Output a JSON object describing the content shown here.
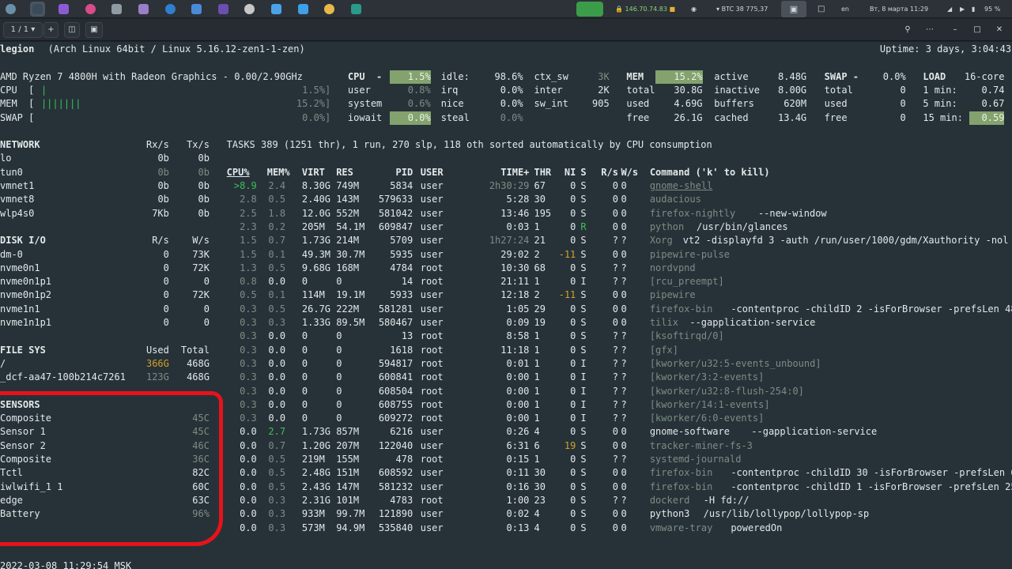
{
  "topbar": {
    "apps": [
      "activities-icon",
      "terminal-icon",
      "firefox-icon",
      "podcast-icon",
      "settings-icon",
      "gimp-icon",
      "vscode-icon",
      "files-icon",
      "proton-icon",
      "obs-icon",
      "atom-icon",
      "chrome-icon",
      "notes-icon",
      "vk-icon"
    ],
    "vpn": "146.70.74.83",
    "btc": "BTC 38 775,37",
    "lang": "en",
    "clock": "Вт, 8 марта  11:29",
    "battery": "95 %"
  },
  "termbar": {
    "tab": "1 / 1",
    "add": "+"
  },
  "hostline": {
    "host": "legion",
    "os": "(Arch Linux 64bit / Linux 5.16.12-zen1-1-zen)",
    "uptime": "Uptime: 3 days, 3:04:43"
  },
  "quick": {
    "cpu_name": "AMD Ryzen 7 4800H with Radeon Graphics - 0.00/2.90GHz",
    "rows": [
      {
        "label": "CPU  [",
        "bar": "|",
        "pct": "1.5%]"
      },
      {
        "label": "MEM  [",
        "bar": "|||||||",
        "pct": "15.2%]"
      },
      {
        "label": "SWAP [",
        "bar": "",
        "pct": "0.0%]"
      }
    ]
  },
  "cpu": {
    "title": "CPU  -",
    "total": "1.5%",
    "col1": [
      [
        "user",
        "0.8%"
      ],
      [
        "system",
        "0.6%"
      ],
      [
        "iowait",
        "0.0%"
      ]
    ],
    "col2": [
      [
        "idle:",
        "98.6%"
      ],
      [
        "irq",
        "0.0%"
      ],
      [
        "nice",
        "0.0%"
      ],
      [
        "steal",
        "0.0%"
      ]
    ],
    "col3": [
      [
        "ctx_sw",
        "3K"
      ],
      [
        "inter",
        "2K"
      ],
      [
        "sw_int",
        "905"
      ]
    ]
  },
  "mem": {
    "title": "MEM  -",
    "total": "15.2%",
    "col1": [
      [
        "total",
        "30.8G"
      ],
      [
        "used",
        "4.69G"
      ],
      [
        "free",
        "26.1G"
      ]
    ],
    "col2": [
      [
        "active",
        "8.48G"
      ],
      [
        "inactive",
        "8.00G"
      ],
      [
        "buffers",
        "620M"
      ],
      [
        "cached",
        "13.4G"
      ]
    ]
  },
  "swap": {
    "title": "SWAP -",
    "total": "0.0%",
    "rows": [
      [
        "total",
        "0"
      ],
      [
        "used",
        "0"
      ],
      [
        "free",
        "0"
      ]
    ]
  },
  "load": {
    "title": "LOAD",
    "cores": "16-core",
    "rows": [
      [
        "1 min:",
        "0.74"
      ],
      [
        "5 min:",
        "0.67"
      ],
      [
        "15 min:",
        "0.59"
      ]
    ]
  },
  "network": {
    "header": [
      "NETWORK",
      "Rx/s",
      "Tx/s"
    ],
    "rows": [
      [
        "lo",
        "0b",
        "0b"
      ],
      [
        "tun0",
        "0b",
        "0b"
      ],
      [
        "vmnet1",
        "0b",
        "0b"
      ],
      [
        "vmnet8",
        "0b",
        "0b"
      ],
      [
        "wlp4s0",
        "7Kb",
        "0b"
      ]
    ]
  },
  "disk": {
    "header": [
      "DISK I/O",
      "R/s",
      "W/s"
    ],
    "rows": [
      [
        "dm-0",
        "0",
        "73K"
      ],
      [
        "nvme0n1",
        "0",
        "72K"
      ],
      [
        "nvme0n1p1",
        "0",
        "0"
      ],
      [
        "nvme0n1p2",
        "0",
        "72K"
      ],
      [
        "nvme1n1",
        "0",
        "0"
      ],
      [
        "nvme1n1p1",
        "0",
        "0"
      ]
    ]
  },
  "fs": {
    "header": [
      "FILE SYS",
      "Used",
      "Total"
    ],
    "rows": [
      [
        "/",
        "366G",
        "468G"
      ],
      [
        "_dcf-aa47-100b214c7261",
        "123G",
        "468G"
      ]
    ]
  },
  "sensors": {
    "header": "SENSORS",
    "rows": [
      [
        "Composite",
        "45C"
      ],
      [
        "Sensor 1",
        "45C"
      ],
      [
        "Sensor 2",
        "46C"
      ],
      [
        "Composite",
        "36C"
      ],
      [
        "Tctl",
        "82C"
      ],
      [
        "iwlwifi_1 1",
        "60C"
      ],
      [
        "edge",
        "63C"
      ],
      [
        "Battery",
        "96%"
      ]
    ]
  },
  "tasks": {
    "summary": "TASKS 389 (1251 thr), 1 run, 270 slp, 118 oth sorted automatically by CPU consumption"
  },
  "proc": {
    "header": [
      "CPU%",
      "MEM%",
      "VIRT",
      "RES",
      "PID",
      "USER",
      "TIME+",
      "THR",
      "NI",
      "S",
      "R/s",
      "W/s",
      "Command ('k' to kill)"
    ],
    "rows": [
      [
        ">8.9",
        "2.4",
        "8.30G",
        "749M",
        "5834",
        "user",
        "2h30:29",
        "67",
        "0",
        "S",
        "0",
        "0",
        "gnome-shell",
        ""
      ],
      [
        "2.8",
        "0.5",
        "2.40G",
        "143M",
        "579633",
        "user",
        "5:28",
        "30",
        "0",
        "S",
        "0",
        "0",
        "audacious",
        ""
      ],
      [
        "2.5",
        "1.8",
        "12.0G",
        "552M",
        "581042",
        "user",
        "13:46",
        "195",
        "0",
        "S",
        "0",
        "0",
        "firefox-nightly",
        " --new-window"
      ],
      [
        "2.3",
        "0.2",
        "205M",
        "54.1M",
        "609847",
        "user",
        "0:03",
        "1",
        "0",
        "R",
        "0",
        "0",
        "python",
        " /usr/bin/glances"
      ],
      [
        "1.5",
        "0.7",
        "1.73G",
        "214M",
        "5709",
        "user",
        "1h27:24",
        "21",
        "0",
        "S",
        "?",
        "?",
        "Xorg",
        " vt2 -displayfd 3 -auth /run/user/1000/gdm/Xauthority -nol"
      ],
      [
        "1.5",
        "0.1",
        "49.3M",
        "30.7M",
        "5935",
        "user",
        "29:02",
        "2",
        "-11",
        "S",
        "0",
        "0",
        "pipewire-pulse",
        ""
      ],
      [
        "1.3",
        "0.5",
        "9.68G",
        "168M",
        "4784",
        "root",
        "10:30",
        "68",
        "0",
        "S",
        "?",
        "?",
        "nordvpnd",
        ""
      ],
      [
        "0.8",
        "0.0",
        "0",
        "0",
        "14",
        "root",
        "21:11",
        "1",
        "0",
        "I",
        "?",
        "?",
        "[rcu_preempt]",
        ""
      ],
      [
        "0.5",
        "0.1",
        "114M",
        "19.1M",
        "5933",
        "user",
        "12:18",
        "2",
        "-11",
        "S",
        "0",
        "0",
        "pipewire",
        ""
      ],
      [
        "0.3",
        "0.5",
        "26.7G",
        "222M",
        "581281",
        "user",
        "1:05",
        "29",
        "0",
        "S",
        "0",
        "0",
        "firefox-bin",
        " -contentproc -childID 2 -isForBrowser -prefsLen 48"
      ],
      [
        "0.3",
        "0.3",
        "1.33G",
        "89.5M",
        "580467",
        "user",
        "0:09",
        "19",
        "0",
        "S",
        "0",
        "0",
        "tilix",
        " --gapplication-service"
      ],
      [
        "0.3",
        "0.0",
        "0",
        "0",
        "13",
        "root",
        "8:58",
        "1",
        "0",
        "S",
        "?",
        "?",
        "[ksoftirqd/0]",
        ""
      ],
      [
        "0.3",
        "0.0",
        "0",
        "0",
        "1618",
        "root",
        "11:18",
        "1",
        "0",
        "S",
        "?",
        "?",
        "[gfx]",
        ""
      ],
      [
        "0.3",
        "0.0",
        "0",
        "0",
        "594817",
        "root",
        "0:01",
        "1",
        "0",
        "I",
        "?",
        "?",
        "[kworker/u32:5-events_unbound]",
        ""
      ],
      [
        "0.3",
        "0.0",
        "0",
        "0",
        "600841",
        "root",
        "0:00",
        "1",
        "0",
        "I",
        "?",
        "?",
        "[kworker/3:2-events]",
        ""
      ],
      [
        "0.3",
        "0.0",
        "0",
        "0",
        "608504",
        "root",
        "0:00",
        "1",
        "0",
        "I",
        "?",
        "?",
        "[kworker/u32:8-flush-254:0]",
        ""
      ],
      [
        "0.3",
        "0.0",
        "0",
        "0",
        "608755",
        "root",
        "0:00",
        "1",
        "0",
        "I",
        "?",
        "?",
        "[kworker/14:1-events]",
        ""
      ],
      [
        "0.3",
        "0.0",
        "0",
        "0",
        "609272",
        "root",
        "0:00",
        "1",
        "0",
        "I",
        "?",
        "?",
        "[kworker/6:0-events]",
        ""
      ],
      [
        "0.0",
        "2.7",
        "1.73G",
        "857M",
        "6216",
        "user",
        "0:26",
        "4",
        "0",
        "S",
        "0",
        "0",
        "gnome-software",
        " --gapplication-service"
      ],
      [
        "0.0",
        "0.7",
        "1.20G",
        "207M",
        "122040",
        "user",
        "6:31",
        "6",
        "19",
        "S",
        "0",
        "0",
        "tracker-miner-fs-3",
        ""
      ],
      [
        "0.0",
        "0.5",
        "219M",
        "155M",
        "478",
        "root",
        "0:15",
        "1",
        "0",
        "S",
        "?",
        "?",
        "systemd-journald",
        ""
      ],
      [
        "0.0",
        "0.5",
        "2.48G",
        "151M",
        "608592",
        "user",
        "0:11",
        "30",
        "0",
        "S",
        "0",
        "0",
        "firefox-bin",
        " -contentproc -childID 30 -isForBrowser -prefsLen 6"
      ],
      [
        "0.0",
        "0.5",
        "2.43G",
        "147M",
        "581232",
        "user",
        "0:16",
        "30",
        "0",
        "S",
        "0",
        "0",
        "firefox-bin",
        " -contentproc -childID 1 -isForBrowser -prefsLen 25"
      ],
      [
        "0.0",
        "0.3",
        "2.31G",
        "101M",
        "4783",
        "root",
        "1:00",
        "23",
        "0",
        "S",
        "?",
        "?",
        "dockerd",
        " -H fd://"
      ],
      [
        "0.0",
        "0.3",
        "933M",
        "99.7M",
        "121890",
        "user",
        "0:02",
        "4",
        "0",
        "S",
        "0",
        "0",
        "python3",
        " /usr/lib/lollypop/lollypop-sp"
      ],
      [
        "0.0",
        "0.3",
        "573M",
        "94.9M",
        "535840",
        "user",
        "0:13",
        "4",
        "0",
        "S",
        "0",
        "0",
        "vmware-tray",
        " poweredOn"
      ]
    ]
  },
  "footer": "2022-03-08 11:29:54 MSK",
  "colors": {
    "bg": "#263238",
    "ok": "#3fbf5b",
    "careful": "#84a26e",
    "warning": "#d3a02a",
    "critical": "#e0504b",
    "annotation": "#e6131b"
  }
}
